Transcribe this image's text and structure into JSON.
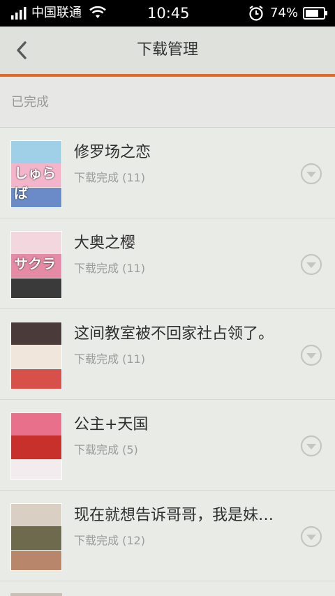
{
  "status_bar": {
    "carrier": "中国联通",
    "time": "10:45",
    "battery": "74%",
    "icons": [
      "signal-icon",
      "wifi-icon",
      "alarm-icon",
      "battery-icon"
    ]
  },
  "header": {
    "title": "下载管理",
    "back_icon": "chevron-left-icon"
  },
  "section": {
    "label": "已完成"
  },
  "items": [
    {
      "title": "修罗场之恋",
      "status": "下载完成 (11)",
      "cover_text": "しゅらば"
    },
    {
      "title": "大奥之樱",
      "status": "下载完成 (11)",
      "cover_text": "サクラ"
    },
    {
      "title": "这间教室被不回家社占领了。",
      "status": "下载完成 (11)",
      "cover_text": ""
    },
    {
      "title": "公主+天国",
      "status": "下载完成 (5)",
      "cover_text": ""
    },
    {
      "title": "现在就想告诉哥哥，我是妹…",
      "status": "下载完成 (12)",
      "cover_text": ""
    }
  ],
  "colors": {
    "accent": "#e06b26",
    "background": "#e9ebe6",
    "header_bg": "#dfe1dc"
  }
}
